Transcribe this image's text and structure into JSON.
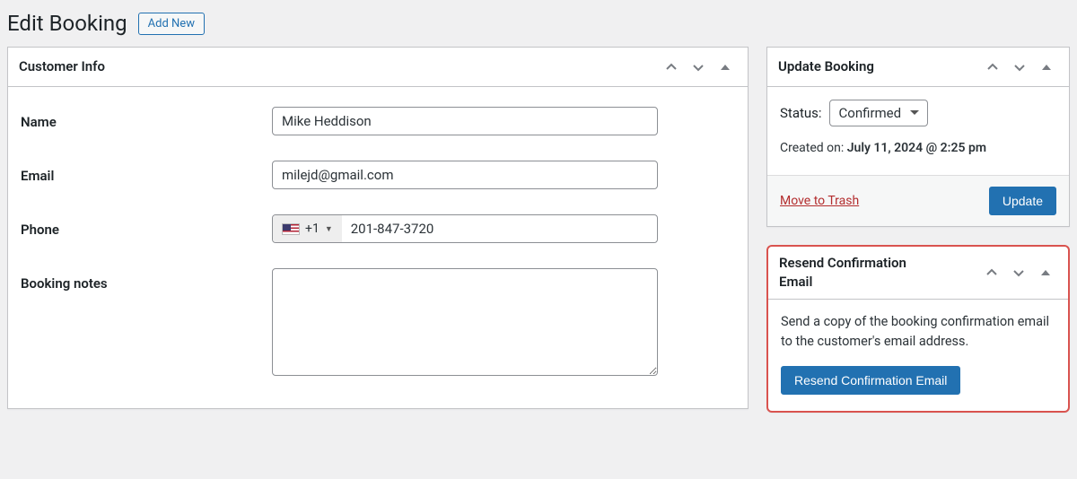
{
  "header": {
    "title": "Edit Booking",
    "add_new": "Add New"
  },
  "customer_info": {
    "box_title": "Customer Info",
    "name_label": "Name",
    "name_value": "Mike Heddison",
    "email_label": "Email",
    "email_value": "milejd@gmail.com",
    "phone_label": "Phone",
    "phone_country_code": "+1",
    "phone_value": "201-847-3720",
    "notes_label": "Booking notes",
    "notes_value": ""
  },
  "update_box": {
    "box_title": "Update Booking",
    "status_label": "Status:",
    "status_value": "Confirmed",
    "created_on_label": "Created on:",
    "created_on_value": "July 11, 2024 @ 2:25 pm",
    "trash_label": "Move to Trash",
    "update_label": "Update"
  },
  "resend_box": {
    "box_title": "Resend Confirmation Email",
    "description": "Send a copy of the booking confirmation email to the customer's email address.",
    "button_label": "Resend Confirmation Email"
  }
}
